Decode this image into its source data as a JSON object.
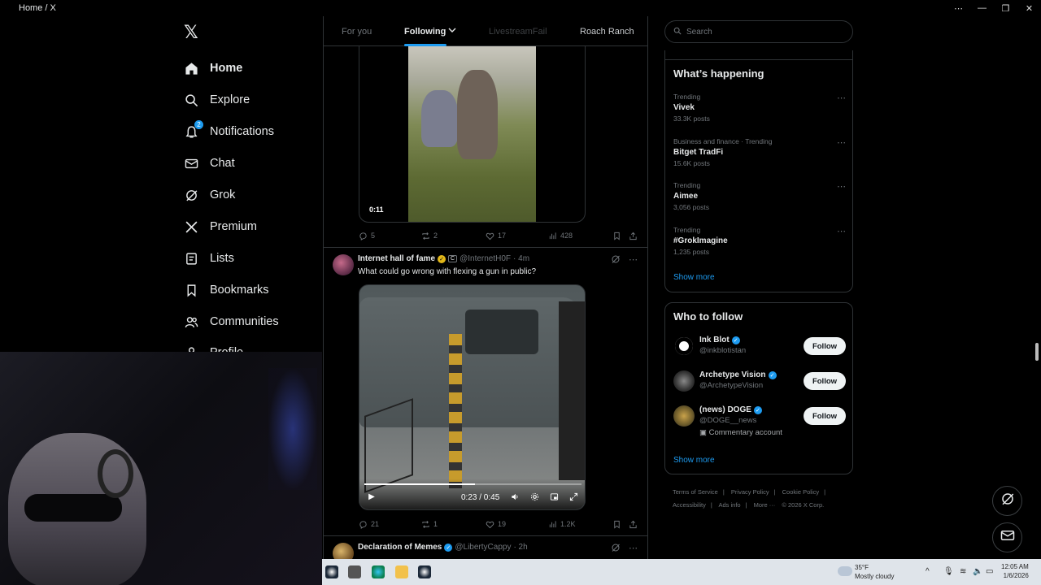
{
  "window": {
    "title": "Home / X"
  },
  "nav": {
    "items": [
      {
        "label": "Home",
        "icon": "home-icon",
        "bold": true
      },
      {
        "label": "Explore",
        "icon": "search-icon"
      },
      {
        "label": "Notifications",
        "icon": "bell-icon",
        "badge": "2"
      },
      {
        "label": "Chat",
        "icon": "mail-icon"
      },
      {
        "label": "Grok",
        "icon": "grok-icon"
      },
      {
        "label": "Premium",
        "icon": "x-logo-icon"
      },
      {
        "label": "Lists",
        "icon": "list-icon"
      },
      {
        "label": "Bookmarks",
        "icon": "bookmark-icon"
      },
      {
        "label": "Communities",
        "icon": "people-icon"
      },
      {
        "label": "Profile",
        "icon": "person-icon"
      }
    ]
  },
  "tabs": [
    {
      "label": "For you"
    },
    {
      "label": "Following"
    },
    {
      "label": "LivestreamFail"
    },
    {
      "label": "Roach Ranch"
    }
  ],
  "feed": {
    "post1": {
      "duration": "0:11",
      "replies": "5",
      "reposts": "2",
      "likes": "17",
      "views": "428"
    },
    "post2": {
      "name": "Internet hall of fame",
      "badge": "C",
      "handle": "@InternetH0F",
      "time": "· 4m",
      "text": "What could go wrong with flexing a gun in public?",
      "video_time": "0:23 / 0:45",
      "progress": 0.51,
      "replies": "21",
      "reposts": "1",
      "likes": "19",
      "views": "1.2K"
    },
    "post3": {
      "name": "Declaration of Memes",
      "handle": "@LibertyCappy",
      "time": "· 2h"
    }
  },
  "search": {
    "placeholder": "Search"
  },
  "trends": {
    "title": "What’s happening",
    "items": [
      {
        "meta": "Trending",
        "topic": "Vivek",
        "posts": "33.3K posts"
      },
      {
        "meta": "Business and finance · Trending",
        "topic": "Bitget TradFi",
        "posts": "15.6K posts"
      },
      {
        "meta": "Trending",
        "topic": "Aimee",
        "posts": "3,056 posts"
      },
      {
        "meta": "Trending",
        "topic": "#GrokImagine",
        "posts": "1,235 posts"
      }
    ],
    "show_more": "Show more"
  },
  "who_to_follow": {
    "title": "Who to follow",
    "items": [
      {
        "name": "Ink Blot",
        "handle": "@inkblotistan",
        "button": "Follow"
      },
      {
        "name": "Archetype Vision",
        "handle": "@ArchetypeVision",
        "button": "Follow"
      },
      {
        "name": "(news) DOGE",
        "handle": "@DOGE__news",
        "extra": "Commentary account",
        "button": "Follow"
      }
    ],
    "show_more": "Show more"
  },
  "footer": {
    "terms": "Terms of Service",
    "privacy": "Privacy Policy",
    "cookie": "Cookie Policy",
    "accessibility": "Accessibility",
    "ads": "Ads info",
    "more": "More ···",
    "copyright": "© 2026 X Corp."
  },
  "taskbar": {
    "temp": "35°F",
    "weather": "Mostly cloudy",
    "time": "12:05 AM",
    "date": "1/6/2026"
  },
  "colors": {
    "accent": "#1d9bf0",
    "gold": "#e2b719",
    "background": "#000000"
  }
}
